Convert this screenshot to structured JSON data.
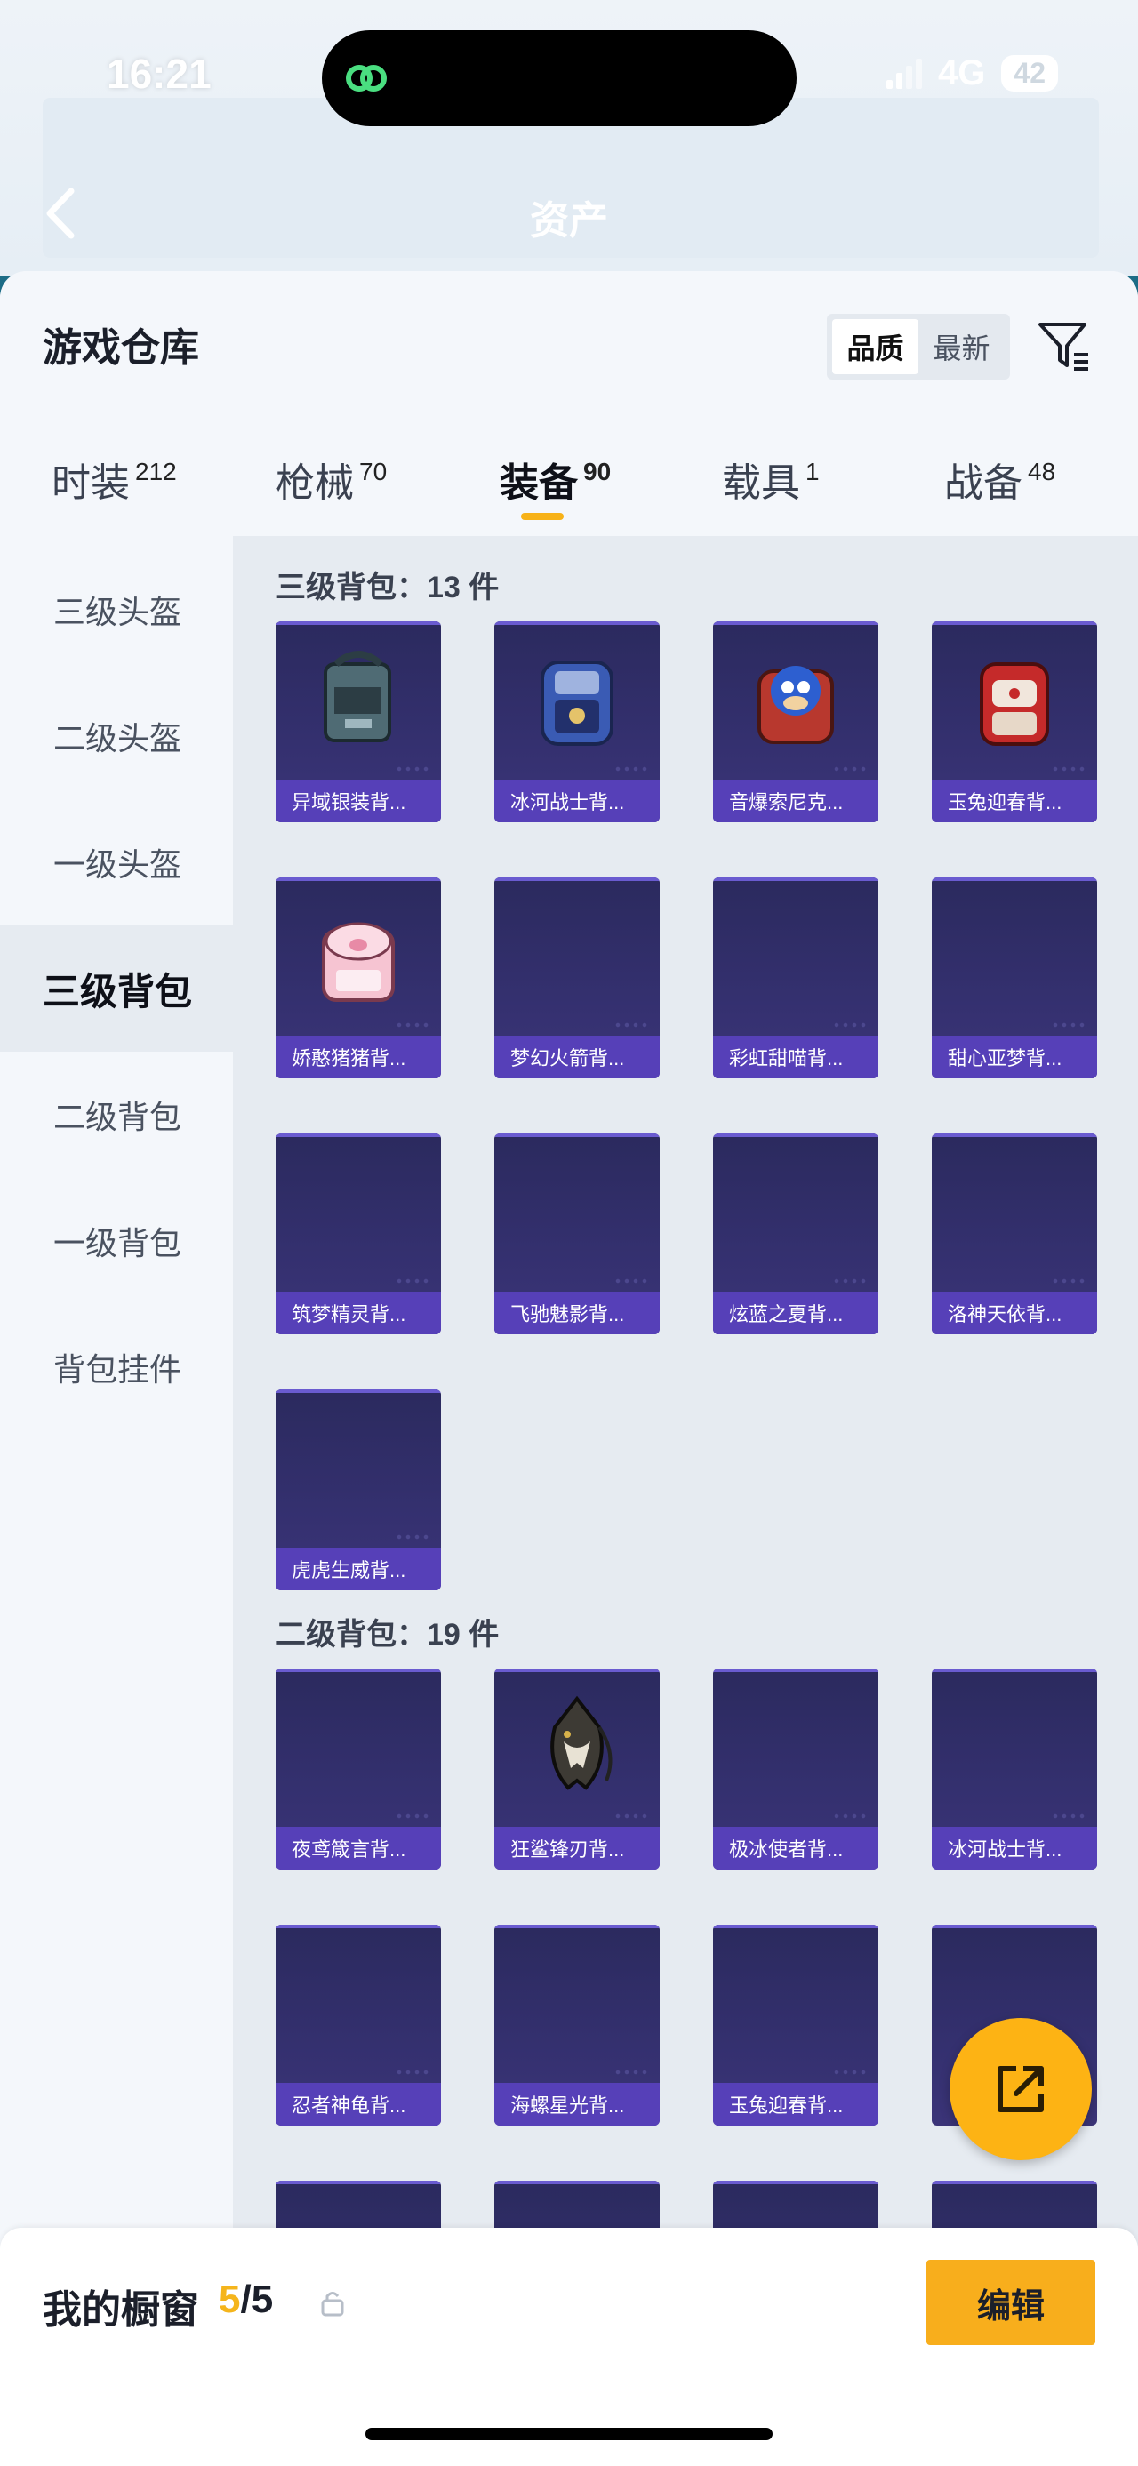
{
  "status_bar": {
    "time": "16:21",
    "network": "4G",
    "battery": "42"
  },
  "header": {
    "title": "资产"
  },
  "sheet": {
    "title": "游戏仓库",
    "sort_options": [
      "品质",
      "最新"
    ],
    "sort_active": "品质"
  },
  "tabs": [
    {
      "label": "时装",
      "count": "212"
    },
    {
      "label": "枪械",
      "count": "70"
    },
    {
      "label": "装备",
      "count": "90"
    },
    {
      "label": "载具",
      "count": "1"
    },
    {
      "label": "战备",
      "count": "48"
    }
  ],
  "active_tab": "装备",
  "sidebar": {
    "items": [
      "三级头盔",
      "二级头盔",
      "一级头盔",
      "三级背包",
      "二级背包",
      "一级背包",
      "背包挂件"
    ],
    "active": "三级背包"
  },
  "sections": [
    {
      "label": "三级背包：13 件",
      "items": [
        "异域银装背...",
        "冰河战士背...",
        "音爆索尼克...",
        "玉兔迎春背...",
        "娇憨猪猪背...",
        "梦幻火箭背...",
        "彩虹甜喵背...",
        "甜心亚梦背...",
        "筑梦精灵背...",
        "飞驰魅影背...",
        "炫蓝之夏背...",
        "洛神天依背...",
        "虎虎生威背..."
      ]
    },
    {
      "label": "二级背包：19 件",
      "items": [
        "夜鸢箴言背...",
        "狂鲨锋刃背...",
        "极冰使者背...",
        "冰河战士背...",
        "忍者神龟背...",
        "海螺星光背...",
        "玉兔迎春背...",
        ""
      ]
    }
  ],
  "bottom_bar": {
    "label": "我的橱窗",
    "count_current": "5",
    "count_total": "/5",
    "edit_label": "编辑"
  },
  "colors": {
    "accent": "#f8ae1c",
    "card_bg": "#2b2a5e",
    "card_label": "#5640b8"
  }
}
